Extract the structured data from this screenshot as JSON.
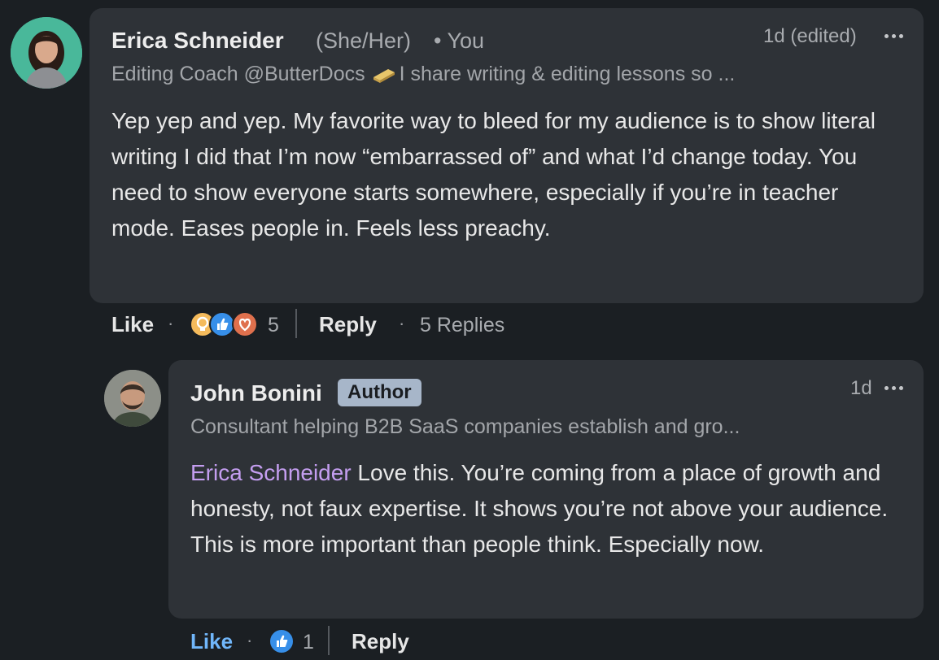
{
  "comments": [
    {
      "author": "Erica Schneider",
      "pronouns": "(She/Her)",
      "relation": "• You",
      "time": "1d (edited)",
      "headline": "Editing Coach @ButterDocs",
      "headline_rest": "I share writing & editing lessons so ...",
      "body": "Yep yep and yep. My favorite way to bleed for my audience is to show literal writing I did that I’m now “embarrassed of” and what I’d change today. You need to show everyone starts somewhere, especially if you’re in teacher mode. Eases people in. Feels less preachy.",
      "like_label": "Like",
      "reaction_count": "5",
      "reply_label": "Reply",
      "replies_label": "5 Replies",
      "reactions": [
        "insightful-icon",
        "like-icon",
        "love-icon"
      ]
    },
    {
      "author": "John Bonini",
      "badge": "Author",
      "time": "1d",
      "headline": "Consultant helping B2B SaaS companies establish and gro...",
      "mention": "Erica Schneider",
      "body": " Love this. You’re coming from a place of growth and honesty, not faux expertise. It shows you’re not above your audience. This is more important than people think. Especially now.",
      "like_label": "Like",
      "reaction_count": "1",
      "reply_label": "Reply",
      "reactions": [
        "like-icon"
      ]
    }
  ],
  "colors": {
    "background": "#1b1f23",
    "bubble": "#2e3237",
    "mention": "#c49ef0",
    "liked": "#71b7fb",
    "badge": "#a7b6c9"
  }
}
